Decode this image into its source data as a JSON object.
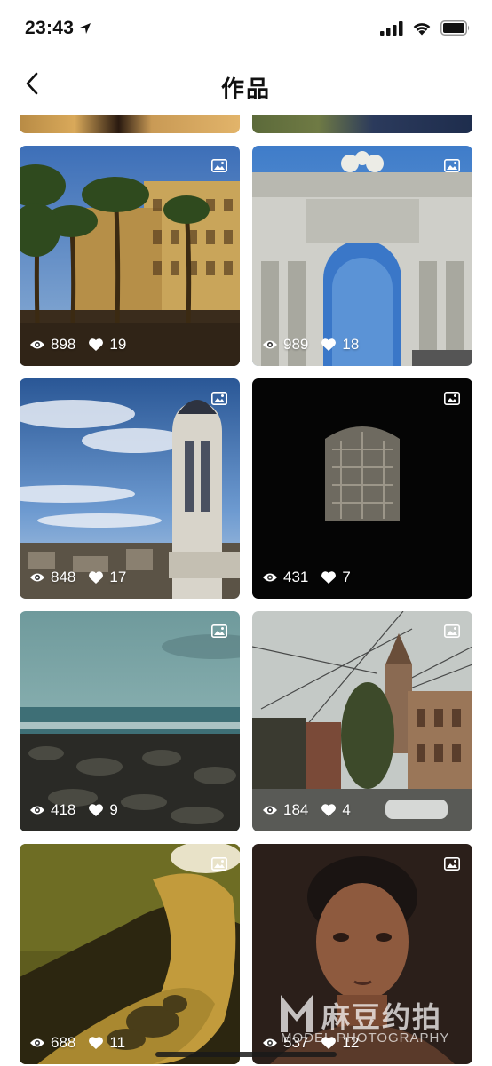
{
  "status_bar": {
    "time": "23:43"
  },
  "nav": {
    "title": "作品"
  },
  "works": [
    {
      "views": "898",
      "likes": "19"
    },
    {
      "views": "989",
      "likes": "18"
    },
    {
      "views": "848",
      "likes": "17"
    },
    {
      "views": "431",
      "likes": "7"
    },
    {
      "views": "418",
      "likes": "9"
    },
    {
      "views": "184",
      "likes": "4"
    },
    {
      "views": "688",
      "likes": "11"
    },
    {
      "views": "537",
      "likes": "12"
    }
  ],
  "watermark": {
    "cn": "麻豆约拍",
    "en": "MODEL PHOTOGRAPHY"
  },
  "icons": {
    "views": "eye-icon",
    "likes": "heart-icon",
    "type": "image-icon",
    "back": "chevron-left-icon",
    "location": "location-arrow-icon",
    "signal": "signal-icon",
    "wifi": "wifi-icon",
    "battery": "battery-icon"
  }
}
